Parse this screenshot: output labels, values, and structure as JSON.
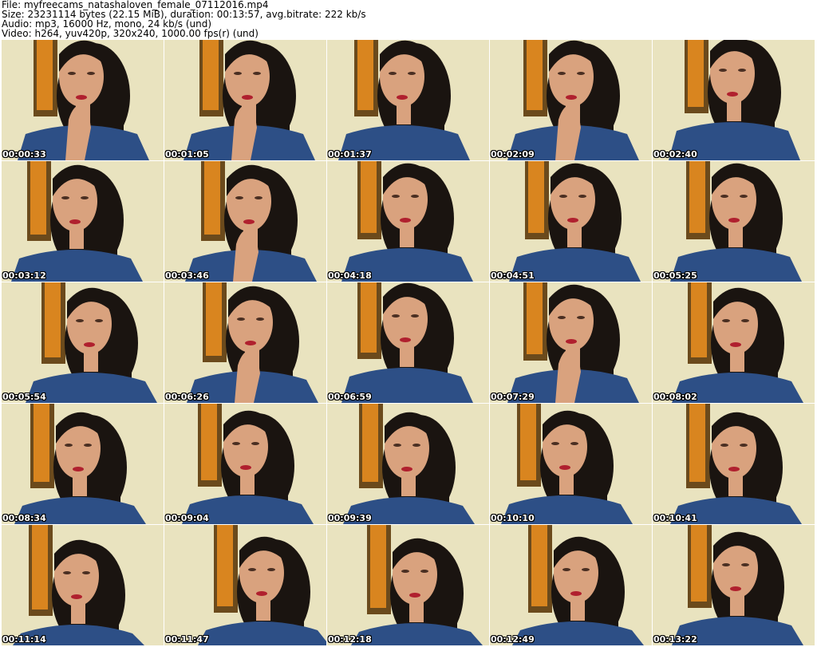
{
  "header": {
    "file_line": "File: myfreecams_natashaloven_female_07112016.mp4",
    "size_line": "Size: 23231114 bytes (22.15 MiB), duration: 00:13:57, avg.bitrate: 222 kb/s",
    "audio_line": "Audio: mp3, 16000 Hz, mono, 24 kb/s (und)",
    "video_line": "Video: h264, yuv420p, 320x240, 1000.00 fps(r) (und)"
  },
  "colors": {
    "wall": "#e9e3bf",
    "frame": "#6b4a1c",
    "poster": "#d9851f",
    "hair": "#1a1410",
    "skin": "#d9a27e",
    "jacket": "#2d4f86",
    "lips": "#b0202e"
  },
  "thumbnails": [
    {
      "timestamp": "00:00:33",
      "hand": true
    },
    {
      "timestamp": "00:01:05",
      "hand": true
    },
    {
      "timestamp": "00:01:37",
      "hand": false
    },
    {
      "timestamp": "00:02:09",
      "hand": true
    },
    {
      "timestamp": "00:02:40",
      "hand": false
    },
    {
      "timestamp": "00:03:12",
      "hand": false
    },
    {
      "timestamp": "00:03:46",
      "hand": true
    },
    {
      "timestamp": "00:04:18",
      "hand": false
    },
    {
      "timestamp": "00:04:51",
      "hand": false
    },
    {
      "timestamp": "00:05:25",
      "hand": false
    },
    {
      "timestamp": "00:05:54",
      "hand": false
    },
    {
      "timestamp": "00:06:26",
      "hand": true
    },
    {
      "timestamp": "00:06:59",
      "hand": false
    },
    {
      "timestamp": "00:07:29",
      "hand": true
    },
    {
      "timestamp": "00:08:02",
      "hand": false
    },
    {
      "timestamp": "00:08:34",
      "hand": false
    },
    {
      "timestamp": "00:09:04",
      "hand": false
    },
    {
      "timestamp": "00:09:39",
      "hand": false
    },
    {
      "timestamp": "00:10:10",
      "hand": false
    },
    {
      "timestamp": "00:10:41",
      "hand": false
    },
    {
      "timestamp": "00:11:14",
      "hand": false
    },
    {
      "timestamp": "00:11:47",
      "hand": false
    },
    {
      "timestamp": "00:12:18",
      "hand": false
    },
    {
      "timestamp": "00:12:49",
      "hand": false
    },
    {
      "timestamp": "00:13:22",
      "hand": false
    }
  ]
}
